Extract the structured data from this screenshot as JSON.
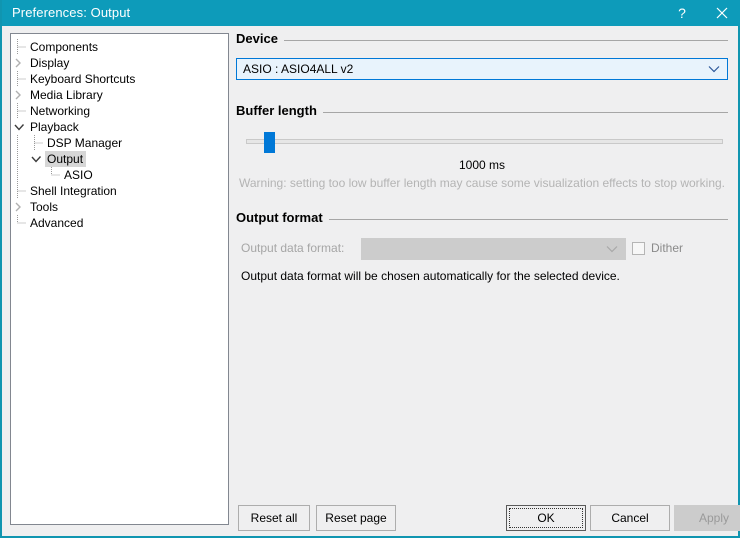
{
  "window": {
    "title": "Preferences: Output",
    "titlebar_color": "#0d9bba",
    "help_icon": "question-mark-icon",
    "close_icon": "close-icon"
  },
  "tree": {
    "items": [
      {
        "label": "Components",
        "depth": 0,
        "state": "leaf",
        "selected": false
      },
      {
        "label": "Display",
        "depth": 0,
        "state": "collapsed",
        "selected": false
      },
      {
        "label": "Keyboard Shortcuts",
        "depth": 0,
        "state": "leaf",
        "selected": false
      },
      {
        "label": "Media Library",
        "depth": 0,
        "state": "collapsed",
        "selected": false
      },
      {
        "label": "Networking",
        "depth": 0,
        "state": "leaf",
        "selected": false
      },
      {
        "label": "Playback",
        "depth": 0,
        "state": "expanded",
        "selected": false
      },
      {
        "label": "DSP Manager",
        "depth": 1,
        "state": "leaf",
        "selected": false
      },
      {
        "label": "Output",
        "depth": 1,
        "state": "expanded",
        "selected": true
      },
      {
        "label": "ASIO",
        "depth": 2,
        "state": "leaf-last",
        "selected": false
      },
      {
        "label": "Shell Integration",
        "depth": 0,
        "state": "leaf",
        "selected": false
      },
      {
        "label": "Tools",
        "depth": 0,
        "state": "collapsed",
        "selected": false
      },
      {
        "label": "Advanced",
        "depth": 0,
        "state": "leaf-last",
        "selected": false
      }
    ]
  },
  "device": {
    "section_title": "Device",
    "selected": "ASIO : ASIO4ALL v2",
    "dropdown_icon": "chevron-down-icon",
    "accent_color": "#0078d7"
  },
  "buffer": {
    "section_title": "Buffer length",
    "value_label": "1000 ms",
    "warning": "Warning: setting too low buffer length may cause some visualization effects to stop working.",
    "thumb_color": "#0078d7"
  },
  "output_format": {
    "section_title": "Output format",
    "field_label": "Output data format:",
    "field_value": "",
    "dropdown_icon": "chevron-down-icon",
    "dither_label": "Dither",
    "dither_checked": false,
    "note": "Output data format will be chosen automatically for the selected device."
  },
  "buttons": {
    "reset_all": "Reset all",
    "reset_page": "Reset page",
    "ok": "OK",
    "cancel": "Cancel",
    "apply": "Apply"
  }
}
